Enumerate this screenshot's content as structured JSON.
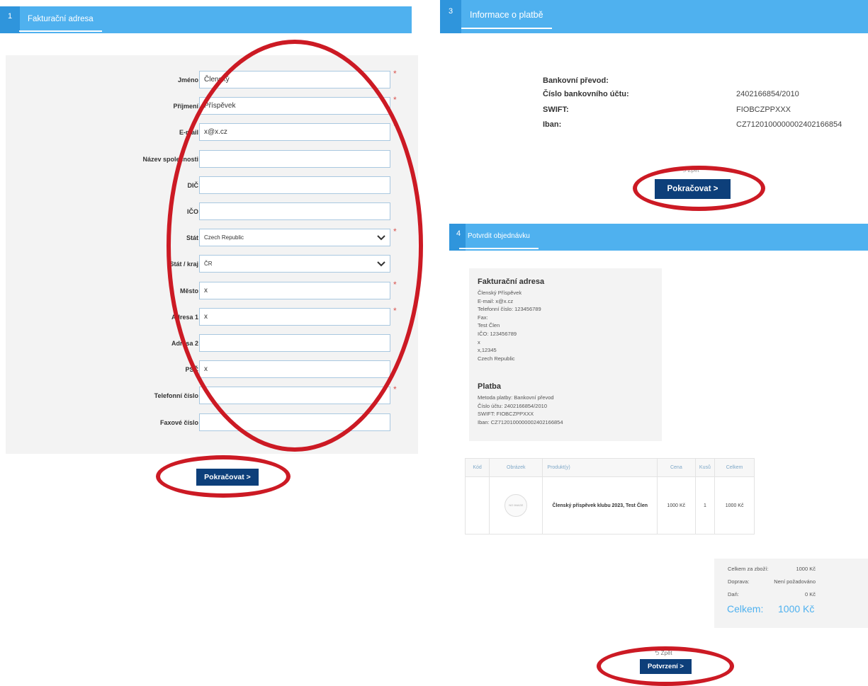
{
  "step1": {
    "number": "1",
    "title": "Fakturační adresa",
    "fields": [
      {
        "label": "Jméno",
        "value": "Členský",
        "required": true
      },
      {
        "label": "Příjmení",
        "value": "Příspěvek",
        "required": true
      },
      {
        "label": "E-mail",
        "value": "x@x.cz",
        "required": true
      },
      {
        "label": "Název společnosti",
        "value": "",
        "required": false
      },
      {
        "label": "DIČ",
        "value": "",
        "required": false
      },
      {
        "label": "IČO",
        "value": "",
        "required": false
      },
      {
        "label": "Stát",
        "value": "Czech Republic",
        "required": true,
        "select": true
      },
      {
        "label": "Stát / kraj",
        "value": "ČR",
        "required": false,
        "select": true
      },
      {
        "label": "Město",
        "value": "x",
        "required": true
      },
      {
        "label": "Adresa 1",
        "value": "x",
        "required": true
      },
      {
        "label": "Adresa 2",
        "value": "",
        "required": false
      },
      {
        "label": "PSČ",
        "value": "x",
        "required": false
      },
      {
        "label": "Telefonní číslo",
        "value": "",
        "required": true
      },
      {
        "label": "Faxové číslo",
        "value": "",
        "required": false
      }
    ],
    "continue_label": "Pokračovat >"
  },
  "step3": {
    "number": "3",
    "title": "Informace o platbě",
    "rows": [
      {
        "label": "Bankovní převod:",
        "value": ""
      },
      {
        "label": "Číslo bankovního účtu:",
        "value": "2402166854/2010"
      },
      {
        "label": "SWIFT:",
        "value": "FIOBCZPPXXX"
      },
      {
        "label": "Iban:",
        "value": "CZ7120100000002402166854"
      }
    ],
    "back_label": "Zpět",
    "continue_label": "Pokračovat >"
  },
  "step4": {
    "number": "4",
    "title": "Potvrdit objednávku",
    "billing": {
      "heading": "Fakturační adresa",
      "lines": [
        "Členský Příspěvek",
        "E-mail: x@x.cz",
        "Telefonní číslo: 123456789",
        "Fax:",
        "Test Člen",
        "IČO: 123456789",
        "x",
        "x,12345",
        "Czech Republic"
      ]
    },
    "payment": {
      "heading": "Platba",
      "lines": [
        "Metoda platby: Bankovní převod",
        "Číslo účtu: 2402166854/2010",
        "SWIFT: FIOBCZPPXXX",
        "Iban: CZ7120100000002402166854"
      ]
    },
    "table": {
      "headers": [
        "Kód",
        "Obrázek",
        "Produkt(y)",
        "Cena",
        "Kusů",
        "Celkem"
      ],
      "row": {
        "code": "",
        "image_text": "NO IMAGE",
        "product": "Členský příspěvek klubu 2023, Test Člen",
        "price": "1000 Kč",
        "qty": "1",
        "total": "1000 Kč"
      }
    },
    "totals": {
      "rows": [
        {
          "label": "Celkem za zboží:",
          "value": "1000 Kč"
        },
        {
          "label": "Doprava:",
          "value": "Není požadováno"
        },
        {
          "label": "Daň:",
          "value": "0 Kč"
        }
      ],
      "grand_label": "Celkem:",
      "grand_value": "1000 Kč"
    },
    "back_label": "Zpět",
    "confirm_label": "Potvrzení >"
  },
  "colors": {
    "step_bar": "#4fb1ef",
    "button": "#0d3f7a",
    "annotation": "#cc1a24"
  }
}
